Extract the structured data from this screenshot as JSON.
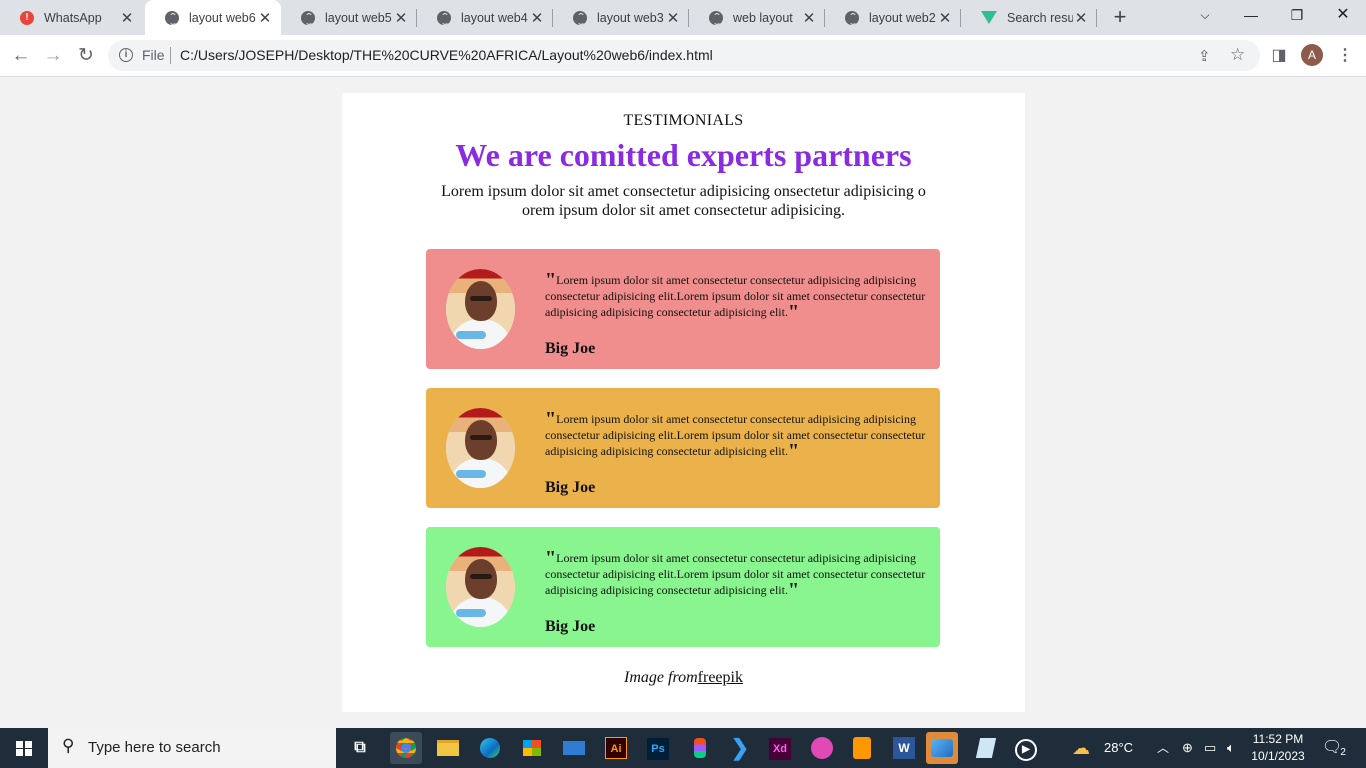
{
  "browser": {
    "tabs": [
      {
        "label": "WhatsApp",
        "icon": "whatsapp-alert-icon",
        "active": false
      },
      {
        "label": "layout web6",
        "icon": "globe-icon",
        "active": true
      },
      {
        "label": "layout web5",
        "icon": "globe-icon",
        "active": false
      },
      {
        "label": "layout web4",
        "icon": "globe-icon",
        "active": false
      },
      {
        "label": "layout web3",
        "icon": "globe-icon",
        "active": false
      },
      {
        "label": "web layout",
        "icon": "globe-icon",
        "active": false
      },
      {
        "label": "layout web2",
        "icon": "globe-icon",
        "active": false
      },
      {
        "label": "Search result",
        "icon": "vue-icon",
        "active": false
      }
    ],
    "address": {
      "scheme_label": "File",
      "url": "C:/Users/JOSEPH/Desktop/THE%20CURVE%20AFRICA/Layout%20web6/index.html"
    },
    "profile_initial": "A"
  },
  "page": {
    "kicker": "TESTIMONIALS",
    "headline": "We are comitted experts partners",
    "intro": "Lorem ipsum dolor sit amet consectetur adipisicing onsectetur adipisicing o orem ipsum dolor sit amet consectetur adipisicing.",
    "testimonials": [
      {
        "quote": "Lorem ipsum dolor sit amet consectetur consectetur adipisicing adipisicing consectetur adipisicing elit.Lorem ipsum dolor sit amet consectetur consectetur adipisicing adipisicing consectetur adipisicing elit.",
        "author": "Big Joe",
        "color": "#ef8e8c"
      },
      {
        "quote": "Lorem ipsum dolor sit amet consectetur consectetur adipisicing adipisicing consectetur adipisicing elit.Lorem ipsum dolor sit amet consectetur consectetur adipisicing adipisicing consectetur adipisicing elit.",
        "author": "Big Joe",
        "color": "#ebb24b"
      },
      {
        "quote": "Lorem ipsum dolor sit amet consectetur consectetur adipisicing adipisicing consectetur adipisicing elit.Lorem ipsum dolor sit amet consectetur consectetur adipisicing adipisicing consectetur adipisicing elit.",
        "author": "Big Joe",
        "color": "#88f58e"
      }
    ],
    "quote_mark": "\"",
    "credit_prefix": "Image from",
    "credit_link": "freepik",
    "accent_color": "#8a2be2"
  },
  "taskbar": {
    "search_placeholder": "Type here to search",
    "apps": [
      "task-view-icon",
      "chrome-icon",
      "file-explorer-icon",
      "edge-icon",
      "store-icon",
      "mail-icon",
      "illustrator-icon",
      "photoshop-icon",
      "figma-icon",
      "vscode-icon",
      "xd-icon",
      "wps-icon",
      "sublime-icon",
      "word-icon",
      "photos-icon",
      "notepad-icon",
      "media-player-icon"
    ],
    "ai_label": "Ai",
    "ps_label": "Ps",
    "xd_label": "Xd",
    "word_label": "W",
    "weather": "28°C",
    "time": "11:52 PM",
    "date": "10/1/2023",
    "notification_count": "2"
  }
}
